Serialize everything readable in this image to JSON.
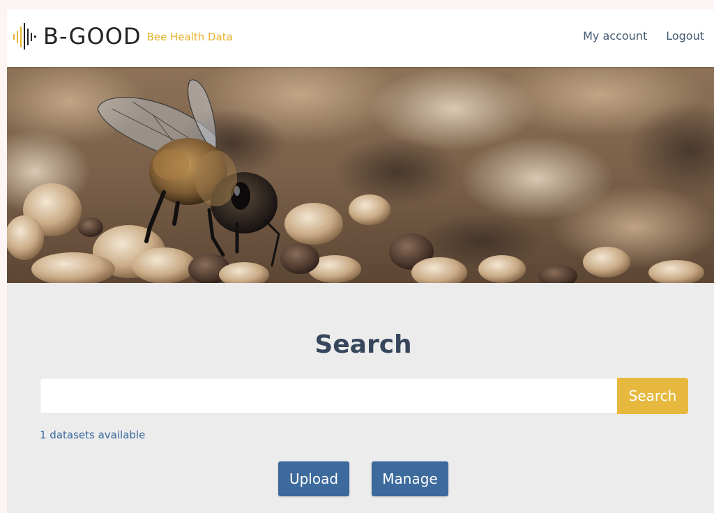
{
  "brand": {
    "name": "B-GOOD",
    "tagline": "Bee Health Data",
    "logo_icon": "soundwave-bars-icon",
    "accent_color": "#e6b32e"
  },
  "nav": {
    "my_account": "My account",
    "logout": "Logout"
  },
  "hero": {
    "image_subject": "bee-on-pebbles-photo"
  },
  "search": {
    "title": "Search",
    "input_value": "",
    "button_label": "Search",
    "button_color": "#e6b93e"
  },
  "datasets": {
    "count_text": "1 datasets available"
  },
  "actions": {
    "upload_label": "Upload",
    "manage_label": "Manage",
    "button_color": "#3d6a9c"
  }
}
